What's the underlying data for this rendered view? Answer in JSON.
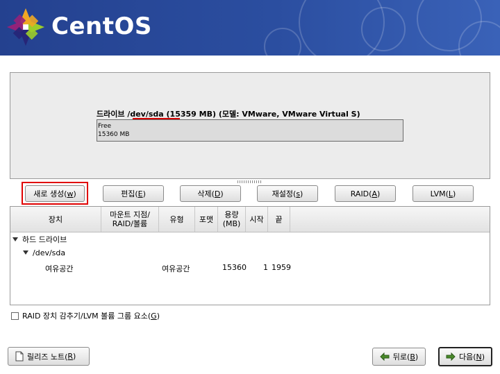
{
  "colors": {
    "header_blue": "#24418f",
    "highlight_red": "#e00000"
  },
  "header": {
    "logo_text": "CentOS"
  },
  "drive": {
    "prefix": "드라이브 ",
    "device": "/dev/sda",
    "info": " (15359 MB) (모델: VMware, VMware Virtual S)",
    "free_label": "Free",
    "free_size": "15360 MB"
  },
  "buttons": {
    "new": {
      "text": "새로 생성(",
      "key": "w",
      "end": ")"
    },
    "edit": {
      "text": "편집(",
      "key": "E",
      "end": ")"
    },
    "delete": {
      "text": "삭제(",
      "key": "D",
      "end": ")"
    },
    "reset": {
      "text": "재설정(",
      "key": "s",
      "end": ")"
    },
    "raid": {
      "text": "RAID(",
      "key": "A",
      "end": ")"
    },
    "lvm": {
      "text": "LVM(",
      "key": "L",
      "end": ")"
    }
  },
  "table": {
    "headers": [
      "장치",
      "마운트 지점/\nRAID/볼륨",
      "유형",
      "포맷",
      "용량\n(MB)",
      "시작",
      "끝"
    ],
    "group": "하드 드라이브",
    "device": "/dev/sda",
    "free_row": {
      "name": "여유공간",
      "type": "여유공간",
      "size": "15360",
      "start": "1",
      "end": "1959"
    }
  },
  "hide_raid": {
    "text": "RAID 장치 감추기/LVM 볼륨 그룹 요소(",
    "key": "G",
    "end": ")"
  },
  "footer": {
    "release_notes": {
      "text": "릴리즈 노트(",
      "key": "R",
      "end": ")"
    },
    "back": {
      "text": "뒤로(",
      "key": "B",
      "end": ")"
    },
    "next": {
      "text": "다음(",
      "key": "N",
      "end": ")"
    }
  }
}
